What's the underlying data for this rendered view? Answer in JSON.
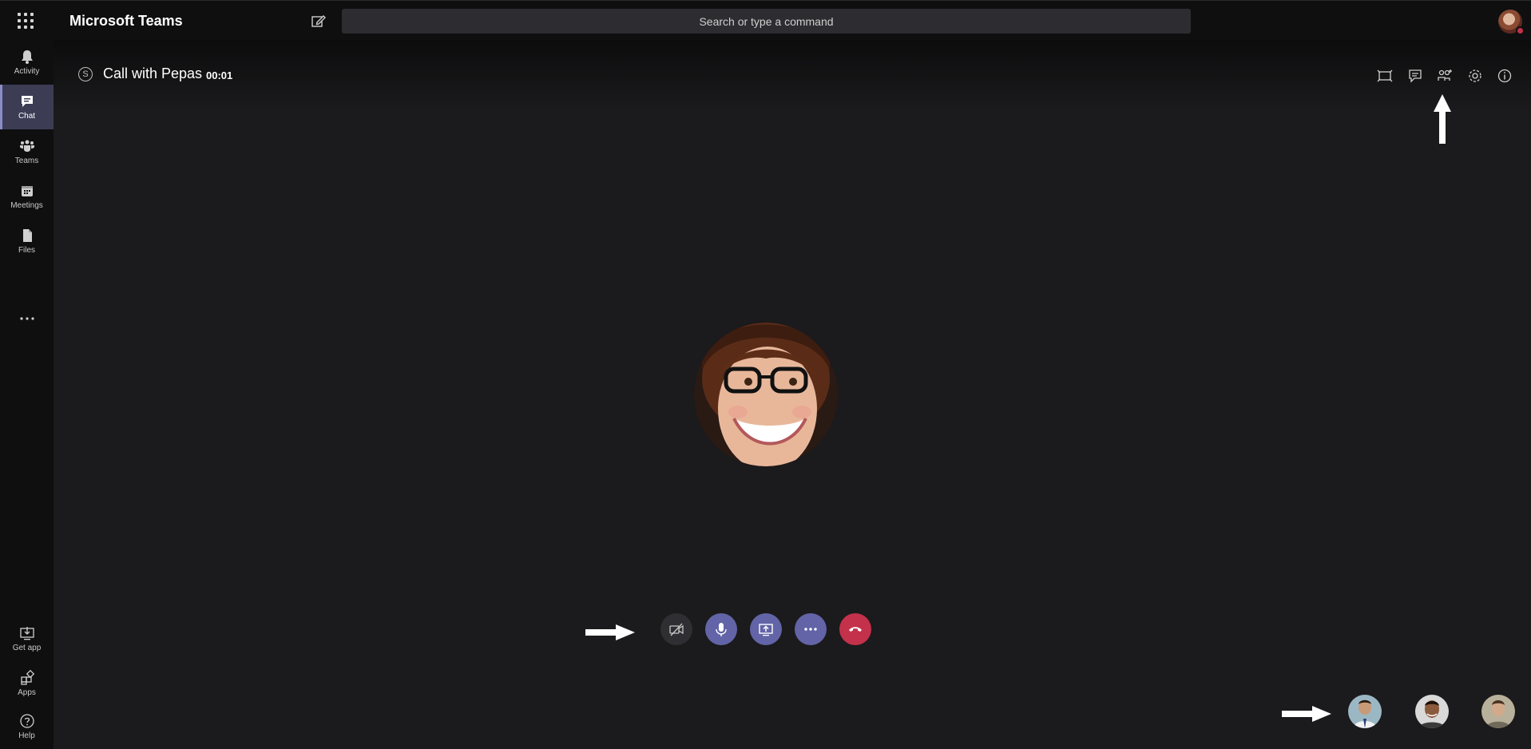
{
  "app": {
    "title": "Microsoft Teams"
  },
  "search": {
    "placeholder": "Search or type a command"
  },
  "rail": {
    "items": [
      {
        "label": "Activity",
        "icon": "bell-icon"
      },
      {
        "label": "Chat",
        "icon": "chat-icon",
        "active": true
      },
      {
        "label": "Teams",
        "icon": "teams-icon"
      },
      {
        "label": "Meetings",
        "icon": "calendar-icon"
      },
      {
        "label": "Files",
        "icon": "file-icon"
      }
    ],
    "bottom": [
      {
        "label": "Get app",
        "icon": "download-icon"
      },
      {
        "label": "Apps",
        "icon": "apps-icon"
      },
      {
        "label": "Help",
        "icon": "help-icon"
      }
    ]
  },
  "call": {
    "title": "Call with Pepas",
    "timer": "00:01"
  },
  "colors": {
    "accent": "#6264a7",
    "hangup": "#c4314b",
    "background": "#1b1a1c",
    "rail": "#0f0f10"
  }
}
